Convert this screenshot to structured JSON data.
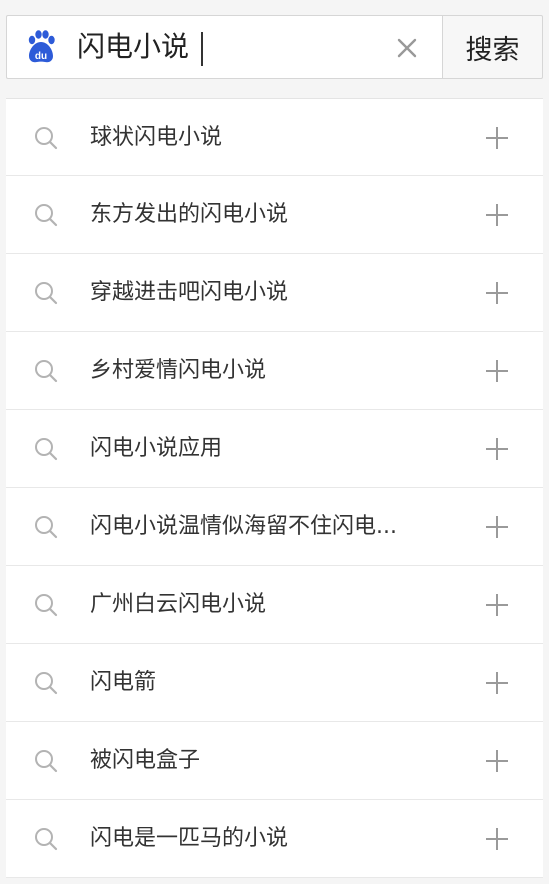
{
  "search": {
    "query": "闪电小说",
    "button_label": "搜索",
    "clear_icon": "close-icon",
    "logo_icon": "baidu-paw-logo"
  },
  "colors": {
    "logo_blue": "#2d5bd8",
    "icon_gray": "#b3b3b3",
    "plus_gray": "#9a9a9a",
    "text": "#333333"
  },
  "suggestions": [
    {
      "text": "球状闪电小说",
      "icon": "search-icon",
      "action_icon": "plus-icon"
    },
    {
      "text": "东方发出的闪电小说",
      "icon": "search-icon",
      "action_icon": "plus-icon"
    },
    {
      "text": "穿越进击吧闪电小说",
      "icon": "search-icon",
      "action_icon": "plus-icon"
    },
    {
      "text": "乡村爱情闪电小说",
      "icon": "search-icon",
      "action_icon": "plus-icon"
    },
    {
      "text": "闪电小说应用",
      "icon": "search-icon",
      "action_icon": "plus-icon"
    },
    {
      "text": "闪电小说温情似海留不住闪电...",
      "icon": "search-icon",
      "action_icon": "plus-icon"
    },
    {
      "text": "广州白云闪电小说",
      "icon": "search-icon",
      "action_icon": "plus-icon"
    },
    {
      "text": "闪电箭",
      "icon": "search-icon",
      "action_icon": "plus-icon"
    },
    {
      "text": "被闪电盒子",
      "icon": "search-icon",
      "action_icon": "plus-icon"
    },
    {
      "text": "闪电是一匹马的小说",
      "icon": "search-icon",
      "action_icon": "plus-icon"
    }
  ]
}
